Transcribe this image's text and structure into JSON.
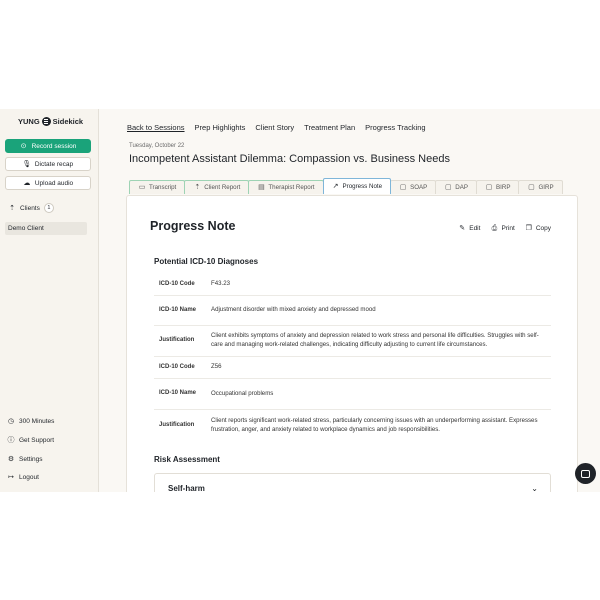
{
  "brand": {
    "name_left": "YUNG",
    "name_right": "Sidekick"
  },
  "sidebar": {
    "record": "Record session",
    "dictate": "Dictate recap",
    "upload": "Upload audio",
    "clients_label": "Clients",
    "clients_count": "1",
    "client_name": "Demo Client",
    "minutes": "300 Minutes",
    "support": "Get Support",
    "settings": "Settings",
    "logout": "Logout"
  },
  "nav": [
    "Back to Sessions",
    "Prep Highlights",
    "Client Story",
    "Treatment Plan",
    "Progress Tracking"
  ],
  "session": {
    "date": "Tuesday, October 22",
    "title": "Incompetent Assistant Dilemma: Compassion vs. Business Needs"
  },
  "tabs": [
    {
      "label": "Transcript",
      "icon": "chat-icon"
    },
    {
      "label": "Client Report",
      "icon": "up-arrow-icon"
    },
    {
      "label": "Therapist Report",
      "icon": "document-icon"
    },
    {
      "label": "Progress Note",
      "icon": "trend-icon"
    },
    {
      "label": "SOAP",
      "icon": "clipboard-icon"
    },
    {
      "label": "DAP",
      "icon": "clipboard-icon"
    },
    {
      "label": "BIRP",
      "icon": "clipboard-icon"
    },
    {
      "label": "GIRP",
      "icon": "clipboard-icon"
    }
  ],
  "note": {
    "heading": "Progress Note",
    "edit": "Edit",
    "print": "Print",
    "copy": "Copy",
    "dx_heading": "Potential ICD-10 Diagnoses",
    "rows": [
      {
        "k": "ICD-10 Code",
        "v": "F43.23"
      },
      {
        "k": "ICD-10 Name",
        "v": "Adjustment disorder with mixed anxiety and depressed mood"
      },
      {
        "k": "Justification",
        "v": "Client exhibits symptoms of anxiety and depression related to work stress and personal life difficulties. Struggles with self-care and managing work-related challenges, indicating difficulty adjusting to current life circumstances."
      },
      {
        "k": "ICD-10 Code",
        "v": "Z56"
      },
      {
        "k": "ICD-10 Name",
        "v": "Occupational problems"
      },
      {
        "k": "Justification",
        "v": "Client reports significant work-related stress, particularly concerning issues with an underperforming assistant. Expresses frustration, anger, and anxiety related to workplace dynamics and job responsibilities."
      }
    ],
    "risk_heading": "Risk Assessment",
    "risk_item": "Self-harm"
  },
  "colors": {
    "accent": "#1aa37a",
    "active_tab_border": "#7fb6d9"
  }
}
